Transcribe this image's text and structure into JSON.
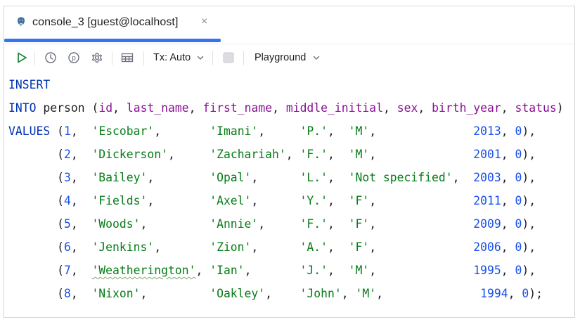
{
  "tab": {
    "title": "console_3 [guest@localhost]",
    "close_glyph": "×"
  },
  "toolbar": {
    "tx_label": "Tx: Auto",
    "playground_label": "Playground",
    "icons": [
      "run-icon",
      "history-icon",
      "parameters-icon",
      "settings-icon",
      "table-layout-icon",
      "stop-icon"
    ]
  },
  "sql": {
    "insert_kw": "INSERT",
    "into_kw": "INTO",
    "table": "person",
    "columns": [
      "id",
      "last_name",
      "first_name",
      "middle_initial",
      "sex",
      "birth_year",
      "status"
    ],
    "values_kw": "VALUES",
    "rows": [
      {
        "id": "1",
        "last_name": "'Escobar'",
        "first_name": "'Imani'",
        "middle_initial": "'P.'",
        "sex": "'M'",
        "birth_year": "2013",
        "status": "0",
        "end": "),"
      },
      {
        "id": "2",
        "last_name": "'Dickerson'",
        "first_name": "'Zachariah'",
        "middle_initial": "'F.'",
        "sex": "'M'",
        "birth_year": "2001",
        "status": "0",
        "end": "),"
      },
      {
        "id": "3",
        "last_name": "'Bailey'",
        "first_name": "'Opal'",
        "middle_initial": "'L.'",
        "sex": "'Not specified'",
        "birth_year": "2003",
        "status": "0",
        "end": "),"
      },
      {
        "id": "4",
        "last_name": "'Fields'",
        "first_name": "'Axel'",
        "middle_initial": "'Y.'",
        "sex": "'F'",
        "birth_year": "2011",
        "status": "0",
        "end": "),"
      },
      {
        "id": "5",
        "last_name": "'Woods'",
        "first_name": "'Annie'",
        "middle_initial": "'F.'",
        "sex": "'F'",
        "birth_year": "2009",
        "status": "0",
        "end": "),"
      },
      {
        "id": "6",
        "last_name": "'Jenkins'",
        "first_name": "'Zion'",
        "middle_initial": "'A.'",
        "sex": "'F'",
        "birth_year": "2006",
        "status": "0",
        "end": "),"
      },
      {
        "id": "7",
        "last_name": "'Weatherington'",
        "first_name": "'Ian'",
        "middle_initial": "'J.'",
        "sex": "'M'",
        "birth_year": "1995",
        "status": "0",
        "end": "),"
      },
      {
        "id": "8",
        "last_name": "'Nixon'",
        "first_name": "'Oakley'",
        "middle_initial": "'John'",
        "sex": "'M'",
        "birth_year": "1994",
        "status": "0",
        "end": ");"
      }
    ]
  },
  "colors": {
    "accent": "#3574f0",
    "keyword": "#0033b3",
    "column": "#871094",
    "string": "#067d17",
    "number": "#1750eb",
    "run": "#208a3c"
  }
}
